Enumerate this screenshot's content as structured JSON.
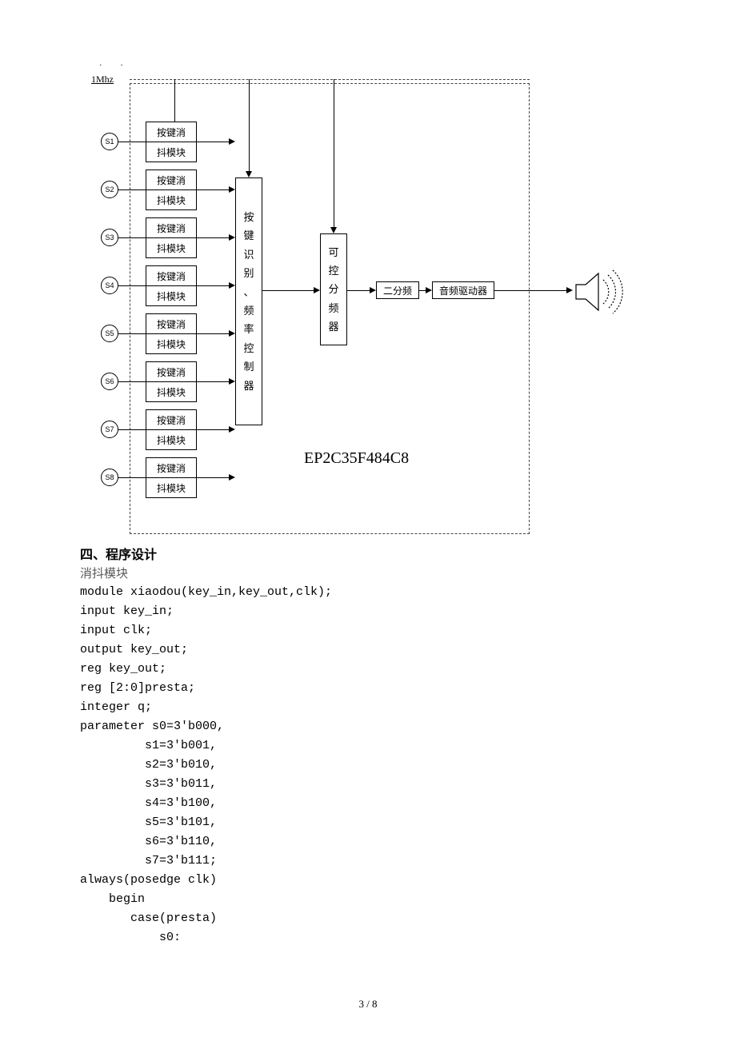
{
  "dots": ".   .",
  "diagram": {
    "clock_label": "1Mhz",
    "keys": [
      "S1",
      "S2",
      "S3",
      "S4",
      "S5",
      "S6",
      "S7",
      "S8"
    ],
    "debounce_top": "按键消",
    "debounce_bot": "抖模块",
    "controller_chars": [
      "按",
      "键",
      "识",
      "别",
      "、",
      "频",
      "率",
      "控",
      "制",
      "器"
    ],
    "divider_chars": [
      "可",
      "控",
      "分",
      "频",
      "器"
    ],
    "div2": "二分频",
    "audio_driver": "音频驱动器",
    "chip": "EP2C35F484C8"
  },
  "heading": "四、程序设计",
  "subheading": "消抖模块",
  "code_lines": [
    "module xiaodou(key_in,key_out,clk);",
    "input key_in;",
    "input clk;",
    "output key_out;",
    "reg key_out;",
    "reg [2:0]presta;",
    "integer q;",
    "parameter s0=3'b000,",
    "         s1=3'b001,",
    "         s2=3'b010,",
    "         s3=3'b011,",
    "         s4=3'b100,",
    "         s5=3'b101,",
    "         s6=3'b110,",
    "         s7=3'b111;",
    "always(posedge clk)",
    "    begin",
    "       case(presta)",
    "           s0:"
  ],
  "page_number": "3 / 8"
}
